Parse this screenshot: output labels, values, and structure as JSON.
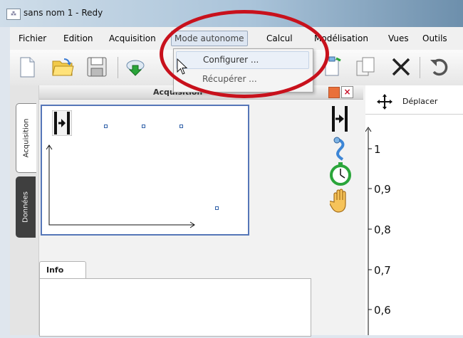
{
  "window": {
    "title": "sans nom 1 - Redy",
    "app_icon": "redy-app-icon"
  },
  "menu": {
    "items": [
      {
        "label": "Fichier"
      },
      {
        "label": "Edition"
      },
      {
        "label": "Acquisition"
      },
      {
        "label": "Mode autonome",
        "active": true
      },
      {
        "label": "Calcul"
      },
      {
        "label": "Modélisation"
      },
      {
        "label": "Vues"
      },
      {
        "label": "Outils"
      }
    ]
  },
  "dropdown": {
    "items": [
      {
        "label": "Configurer ...",
        "highlighted": true
      },
      {
        "label": "Récupérer ..."
      }
    ]
  },
  "toolbar": {
    "icons": [
      "new-document-icon",
      "open-folder-icon",
      "save-floppy-icon",
      "cloud-download-icon",
      "paste-icon",
      "copy-icon",
      "delete-x-icon",
      "undo-icon"
    ]
  },
  "sidebar": {
    "tabs": [
      {
        "label": "Acquisition",
        "active": true
      },
      {
        "label": "Données",
        "active": false
      }
    ]
  },
  "acquisition_panel": {
    "title": "Acquisition",
    "info_tab": "Info"
  },
  "side_icons": [
    "trigger-marker-icon",
    "probe-icon",
    "stopwatch-icon",
    "hand-icon"
  ],
  "right_panel": {
    "move_label": "Déplacer",
    "move_icon": "move-arrows-icon",
    "y_ticks": [
      "1",
      "0,9",
      "0,8",
      "0,7",
      "0,6"
    ]
  },
  "colors": {
    "highlight_ellipse": "#c8111c",
    "diagram_border": "#5576b8",
    "minimize": "#e9703a"
  }
}
